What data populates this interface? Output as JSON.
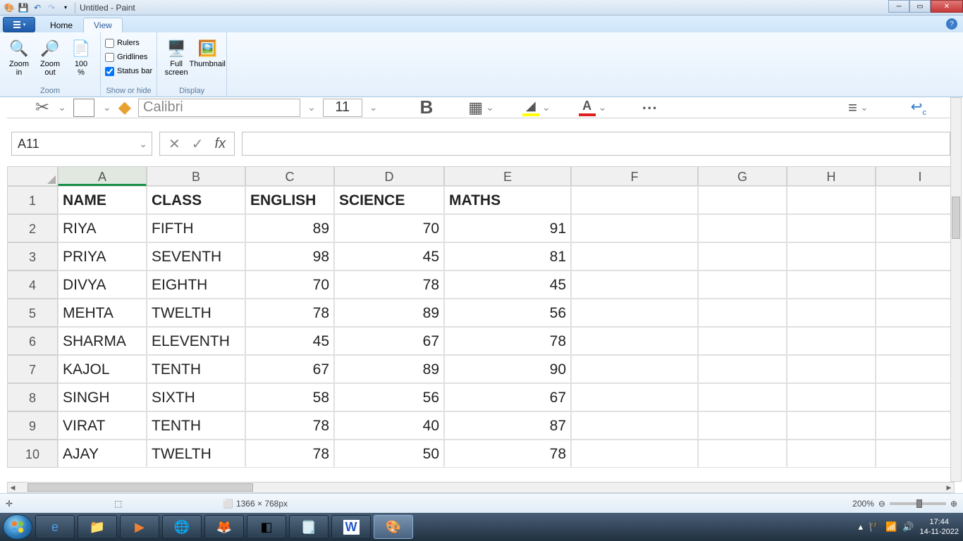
{
  "titlebar": {
    "title": "Untitled - Paint"
  },
  "tabs": {
    "home": "Home",
    "view": "View"
  },
  "ribbon": {
    "zoom": {
      "in": "Zoom\nin",
      "out": "Zoom\nout",
      "hundred": "100\n%",
      "group": "Zoom"
    },
    "showhide": {
      "rulers": "Rulers",
      "gridlines": "Gridlines",
      "statusbar": "Status bar",
      "group": "Show or hide"
    },
    "display": {
      "full": "Full\nscreen",
      "thumb": "Thumbnail",
      "group": "Display"
    }
  },
  "excel": {
    "font_name": "Calibri",
    "font_size": "11",
    "name_box": "A11",
    "columns": [
      "A",
      "B",
      "C",
      "D",
      "E",
      "F",
      "G",
      "H",
      "I"
    ],
    "headers": [
      "NAME",
      "CLASS",
      "ENGLISH",
      "SCIENCE",
      "MATHS"
    ],
    "rows": [
      {
        "n": "1"
      },
      {
        "n": "2",
        "name": "RIYA",
        "class": "FIFTH",
        "eng": "89",
        "sci": "70",
        "math": "91"
      },
      {
        "n": "3",
        "name": "PRIYA",
        "class": "SEVENTH",
        "eng": "98",
        "sci": "45",
        "math": "81"
      },
      {
        "n": "4",
        "name": "DIVYA",
        "class": "EIGHTH",
        "eng": "70",
        "sci": "78",
        "math": "45"
      },
      {
        "n": "5",
        "name": "MEHTA",
        "class": "TWELTH",
        "eng": "78",
        "sci": "89",
        "math": "56"
      },
      {
        "n": "6",
        "name": "SHARMA",
        "class": "ELEVENTH",
        "eng": "45",
        "sci": "67",
        "math": "78"
      },
      {
        "n": "7",
        "name": "KAJOL",
        "class": "TENTH",
        "eng": "67",
        "sci": "89",
        "math": "90"
      },
      {
        "n": "8",
        "name": "SINGH",
        "class": "SIXTH",
        "eng": "58",
        "sci": "56",
        "math": "67"
      },
      {
        "n": "9",
        "name": "VIRAT",
        "class": "TENTH",
        "eng": "78",
        "sci": "40",
        "math": "87"
      },
      {
        "n": "10",
        "name": "AJAY",
        "class": "TWELTH",
        "eng": "78",
        "sci": "50",
        "math": "78"
      }
    ]
  },
  "status": {
    "canvas_size": "1366 × 768px",
    "zoom": "200%"
  },
  "tray": {
    "time": "17:44",
    "date": "14-11-2022"
  }
}
